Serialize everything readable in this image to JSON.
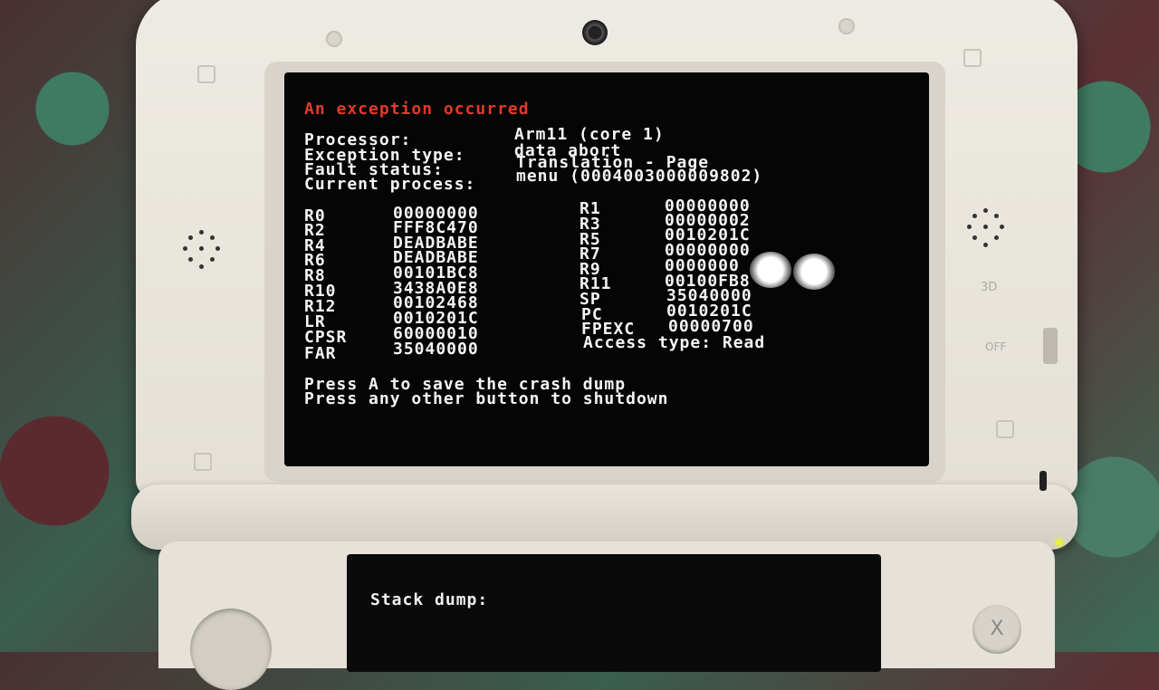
{
  "top_screen": {
    "title": "An exception occurred",
    "info": [
      {
        "label": "Processor:",
        "value": "Arm11 (core 1)"
      },
      {
        "label": "Exception type:",
        "value": "data abort"
      },
      {
        "label": "Fault status:",
        "value": "Translation - Page"
      },
      {
        "label": "Current process:",
        "value": "menu (0004003000009802)"
      }
    ],
    "registers_left": [
      {
        "name": "R0",
        "value": "00000000"
      },
      {
        "name": "R2",
        "value": "FFF8C470"
      },
      {
        "name": "R4",
        "value": "DEADBABE"
      },
      {
        "name": "R6",
        "value": "DEADBABE"
      },
      {
        "name": "R8",
        "value": "00101BC8"
      },
      {
        "name": "R10",
        "value": "3438A0E8"
      },
      {
        "name": "R12",
        "value": "00102468"
      },
      {
        "name": "LR",
        "value": "0010201C"
      },
      {
        "name": "CPSR",
        "value": "60000010"
      },
      {
        "name": "FAR",
        "value": "35040000"
      }
    ],
    "registers_right": [
      {
        "name": "R1",
        "value": "00000000"
      },
      {
        "name": "R3",
        "value": "00000002"
      },
      {
        "name": "R5",
        "value": "0010201C"
      },
      {
        "name": "R7",
        "value": "00000000"
      },
      {
        "name": "R9",
        "value": "0000000"
      },
      {
        "name": "R11",
        "value": "00100FB8"
      },
      {
        "name": "SP",
        "value": "35040000"
      },
      {
        "name": "PC",
        "value": "0010201C"
      },
      {
        "name": "FPEXC",
        "value": "00000700"
      }
    ],
    "access_type": "Access type: Read",
    "prompt_save": "Press A to save the crash dump",
    "prompt_shutdown": "Press any other button to shutdown"
  },
  "bottom_screen": {
    "stack_dump_label": "Stack dump:"
  },
  "device": {
    "label_3d": "3D",
    "label_off": "OFF",
    "x_button": "X"
  },
  "colors": {
    "title_red": "#e23a2a",
    "text": "#f4f4f4",
    "screen_bg": "#050505",
    "shell": "#eeebe4"
  }
}
